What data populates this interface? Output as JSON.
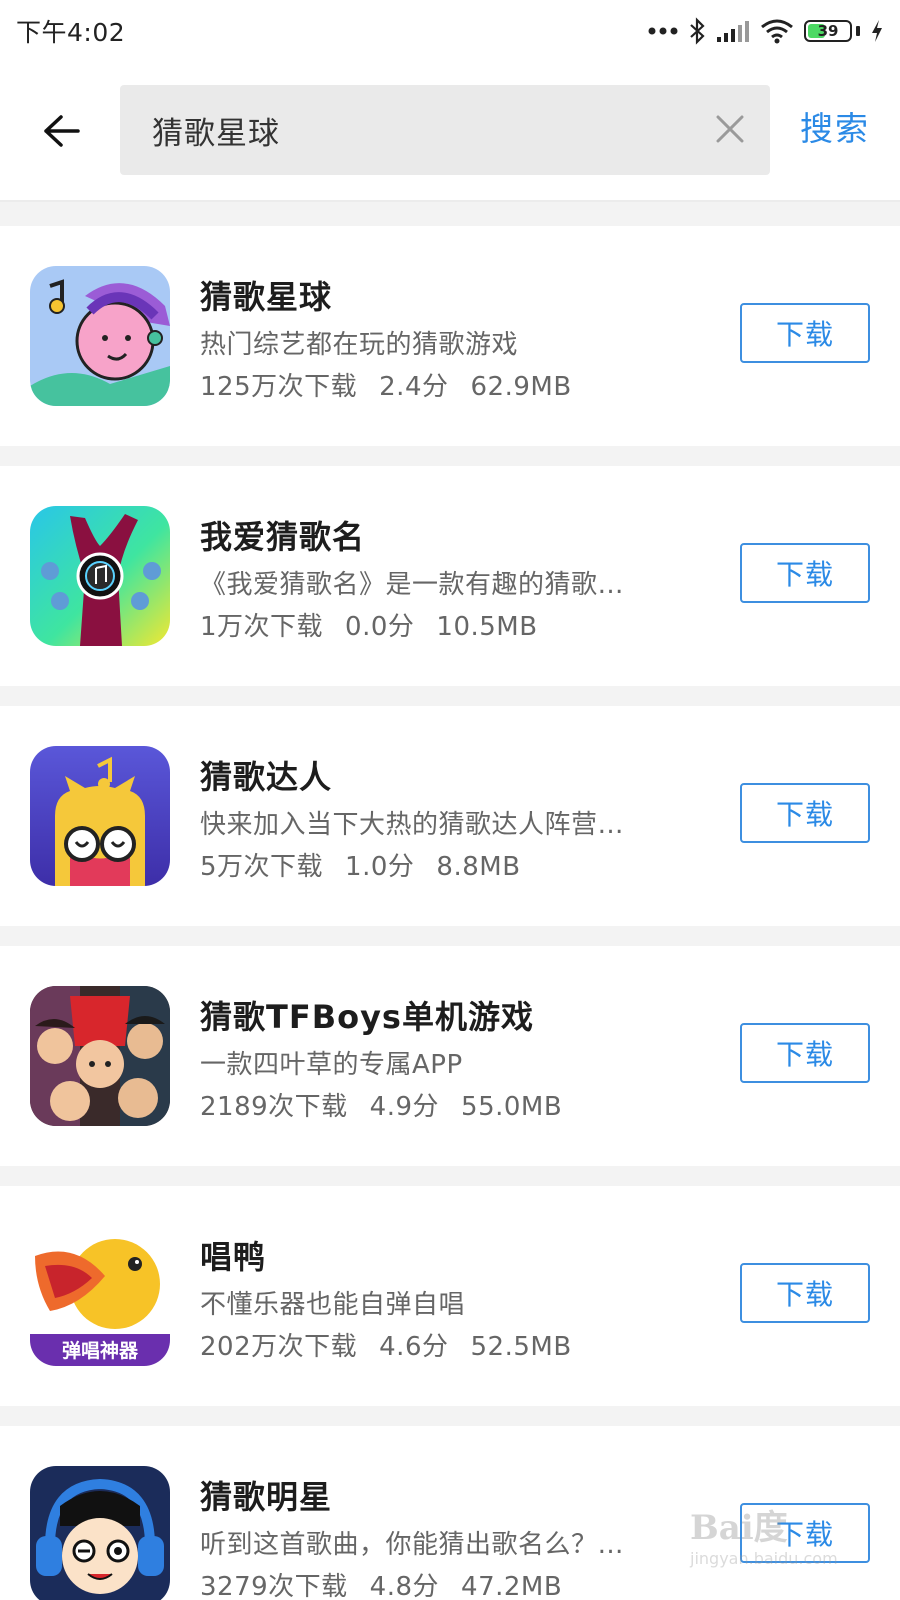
{
  "status_bar": {
    "time": "下午4:02",
    "battery_level": "39",
    "icons": [
      "more-icon",
      "bluetooth-icon",
      "signal-icon",
      "wifi-icon",
      "battery-icon",
      "charging-icon"
    ]
  },
  "header": {
    "search_value": "猜歌星球",
    "search_button": "搜索"
  },
  "apps": [
    {
      "name": "猜歌星球",
      "desc": "热门综艺都在玩的猜歌游戏",
      "downloads": "125万次下载",
      "rating": "2.4分",
      "size": "62.9MB",
      "button": "下载"
    },
    {
      "name": "我爱猜歌名",
      "desc": "《我爱猜歌名》是一款有趣的猜歌…",
      "downloads": "1万次下载",
      "rating": "0.0分",
      "size": "10.5MB",
      "button": "下载"
    },
    {
      "name": "猜歌达人",
      "desc": "快来加入当下大热的猜歌达人阵营…",
      "downloads": "5万次下载",
      "rating": "1.0分",
      "size": "8.8MB",
      "button": "下载"
    },
    {
      "name": "猜歌TFBoys单机游戏",
      "desc": "一款四叶草的专属APP",
      "downloads": "2189次下载",
      "rating": "4.9分",
      "size": "55.0MB",
      "button": "下载"
    },
    {
      "name": "唱鸭",
      "desc": "不懂乐器也能自弹自唱",
      "downloads": "202万次下载",
      "rating": "4.6分",
      "size": "52.5MB",
      "button": "下载",
      "icon_label": "弹唱神器"
    },
    {
      "name": "猜歌明星",
      "desc": "听到这首歌曲，你能猜出歌名么？…",
      "downloads": "3279次下载",
      "rating": "4.8分",
      "size": "47.2MB",
      "button": "下载"
    }
  ],
  "watermark": {
    "main": "Bai度",
    "sub": "jingyan.baidu.com"
  },
  "colors": {
    "accent": "#2b8ae6",
    "background": "#f3f3f3",
    "search_box": "#eaeaea"
  }
}
